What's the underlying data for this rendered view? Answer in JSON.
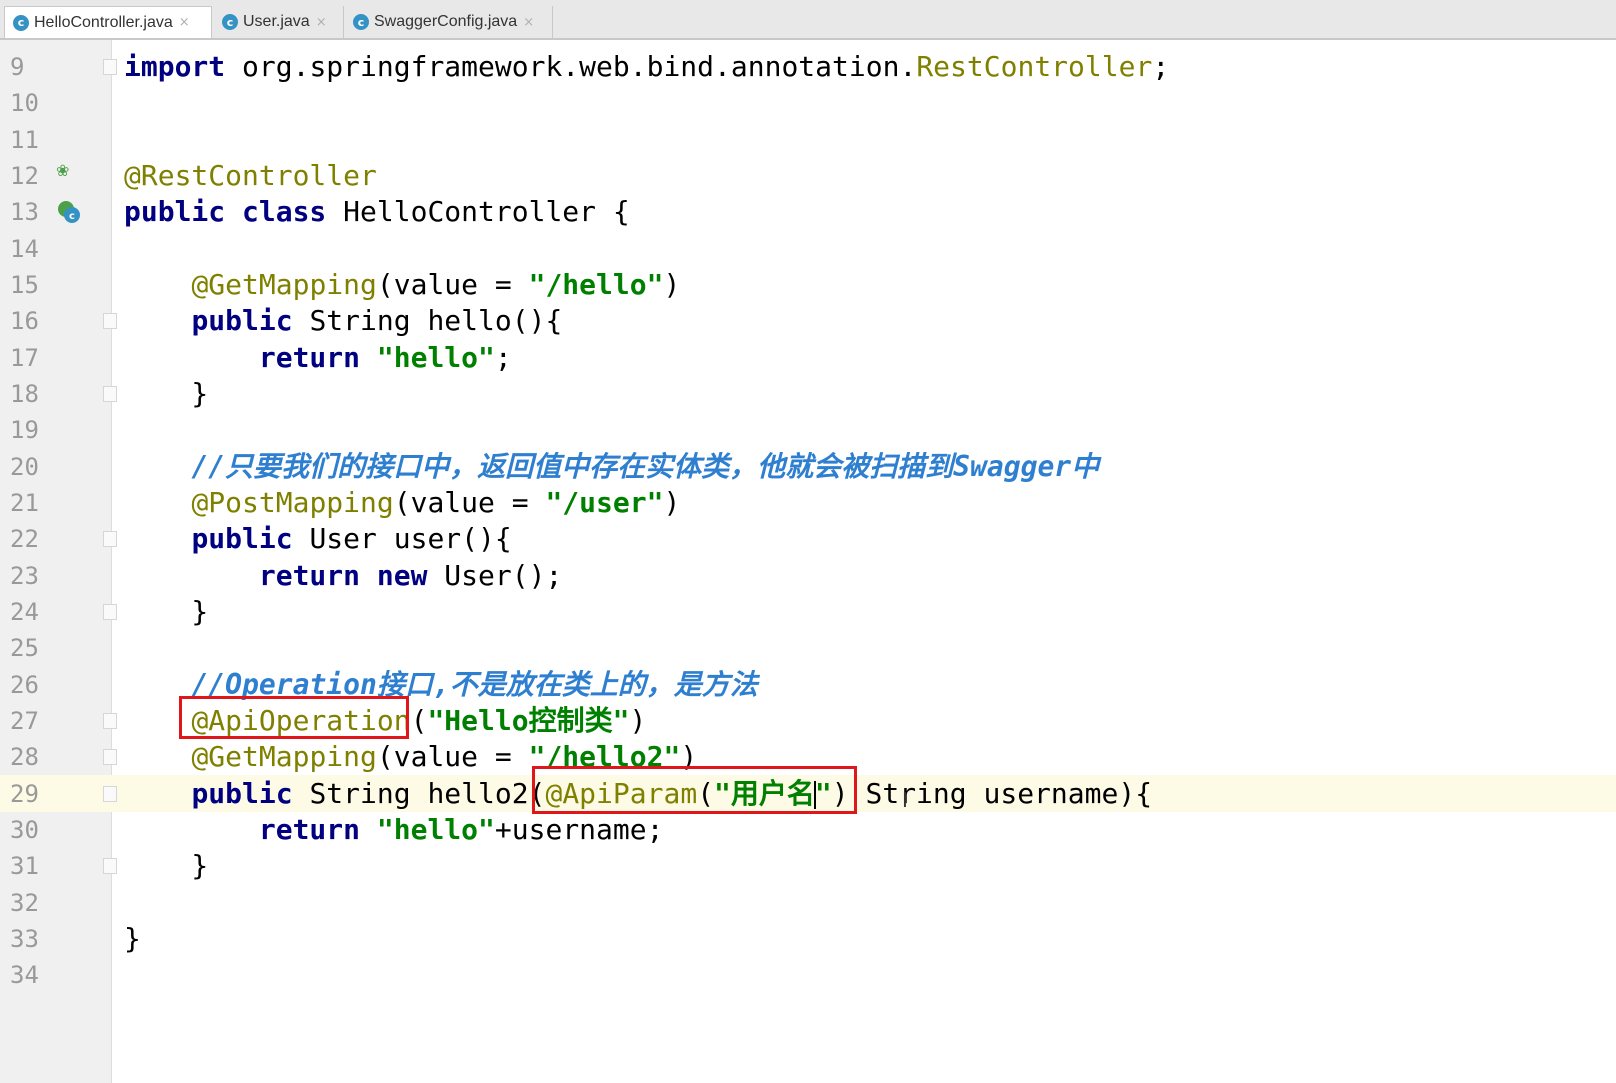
{
  "tabs": [
    {
      "label": "HelloController.java",
      "active": true,
      "icon": "java-class-icon",
      "icon_glyph": "c",
      "close_glyph": "×"
    },
    {
      "label": "User.java",
      "active": false,
      "icon": "java-class-icon",
      "icon_glyph": "c",
      "close_glyph": "×"
    },
    {
      "label": "SwaggerConfig.java",
      "active": false,
      "icon": "java-class-icon",
      "icon_glyph": "c",
      "close_glyph": "×"
    }
  ],
  "editor": {
    "current_line": 29,
    "lines": [
      {
        "n": "9",
        "segments": [
          [
            "kw",
            "import"
          ],
          [
            "plain",
            " org.springframework.web.bind.annotation."
          ],
          [
            "ann",
            "RestController"
          ],
          [
            "plain",
            ";"
          ]
        ],
        "fold": true
      },
      {
        "n": "10",
        "segments": []
      },
      {
        "n": "11",
        "segments": []
      },
      {
        "n": "12",
        "segments": [
          [
            "ann",
            "@RestController"
          ]
        ],
        "gutter_icon": "spring-bean-icon"
      },
      {
        "n": "13",
        "segments": [
          [
            "kw",
            "public class"
          ],
          [
            "plain",
            " HelloController {"
          ]
        ],
        "gutter_icon": "class-icon"
      },
      {
        "n": "14",
        "segments": []
      },
      {
        "n": "15",
        "segments": [
          [
            "plain",
            "    "
          ],
          [
            "ann",
            "@GetMapping"
          ],
          [
            "plain",
            "(value = "
          ],
          [
            "str",
            "\"/hello\""
          ],
          [
            "plain",
            ")"
          ]
        ]
      },
      {
        "n": "16",
        "segments": [
          [
            "plain",
            "    "
          ],
          [
            "kw",
            "public"
          ],
          [
            "plain",
            " String hello(){"
          ]
        ],
        "fold": true
      },
      {
        "n": "17",
        "segments": [
          [
            "plain",
            "        "
          ],
          [
            "kw",
            "return"
          ],
          [
            "plain",
            " "
          ],
          [
            "str",
            "\"hello\""
          ],
          [
            "plain",
            ";"
          ]
        ]
      },
      {
        "n": "18",
        "segments": [
          [
            "plain",
            "    }"
          ]
        ],
        "fold": true
      },
      {
        "n": "19",
        "segments": []
      },
      {
        "n": "20",
        "segments": [
          [
            "plain",
            "    "
          ],
          [
            "cmt",
            "//只要我们的接口中，返回值中存在实体类，他就会被扫描到Swagger中"
          ]
        ]
      },
      {
        "n": "21",
        "segments": [
          [
            "plain",
            "    "
          ],
          [
            "ann",
            "@PostMapping"
          ],
          [
            "plain",
            "(value = "
          ],
          [
            "str",
            "\"/user\""
          ],
          [
            "plain",
            ")"
          ]
        ]
      },
      {
        "n": "22",
        "segments": [
          [
            "plain",
            "    "
          ],
          [
            "kw",
            "public"
          ],
          [
            "plain",
            " User user(){"
          ]
        ],
        "fold": true
      },
      {
        "n": "23",
        "segments": [
          [
            "plain",
            "        "
          ],
          [
            "kw",
            "return new"
          ],
          [
            "plain",
            " User();"
          ]
        ]
      },
      {
        "n": "24",
        "segments": [
          [
            "plain",
            "    }"
          ]
        ],
        "fold": true
      },
      {
        "n": "25",
        "segments": []
      },
      {
        "n": "26",
        "segments": [
          [
            "plain",
            "    "
          ],
          [
            "cmt",
            "//Operation接口,不是放在类上的，是方法"
          ]
        ]
      },
      {
        "n": "27",
        "segments": [
          [
            "plain",
            "    "
          ],
          [
            "ann",
            "@ApiOperation"
          ],
          [
            "plain",
            "("
          ],
          [
            "str",
            "\"Hello控制类\""
          ],
          [
            "plain",
            ")"
          ]
        ],
        "fold": true
      },
      {
        "n": "28",
        "segments": [
          [
            "plain",
            "    "
          ],
          [
            "ann",
            "@GetMapping"
          ],
          [
            "plain",
            "(value = "
          ],
          [
            "str",
            "\"/hello2\""
          ],
          [
            "plain",
            ")"
          ]
        ],
        "fold": true
      },
      {
        "n": "29",
        "segments": [
          [
            "plain",
            "    "
          ],
          [
            "kw",
            "public"
          ],
          [
            "plain",
            " String hello2("
          ],
          [
            "ann",
            "@ApiParam"
          ],
          [
            "plain",
            "("
          ],
          [
            "str",
            "\"用户名"
          ],
          [
            "caret",
            ""
          ],
          [
            "str",
            "\""
          ],
          [
            "plain",
            ") String username){"
          ]
        ],
        "fold": true
      },
      {
        "n": "30",
        "segments": [
          [
            "plain",
            "        "
          ],
          [
            "kw",
            "return"
          ],
          [
            "plain",
            " "
          ],
          [
            "str",
            "\"hello\""
          ],
          [
            "plain",
            "+username;"
          ]
        ]
      },
      {
        "n": "31",
        "segments": [
          [
            "plain",
            "    }"
          ]
        ],
        "fold": true
      },
      {
        "n": "32",
        "segments": []
      },
      {
        "n": "33",
        "segments": [
          [
            "plain",
            "}"
          ]
        ]
      },
      {
        "n": "34",
        "segments": []
      }
    ]
  },
  "highlights": [
    {
      "name": "api-operation-highlight"
    },
    {
      "name": "api-param-highlight"
    }
  ],
  "colors": {
    "keyword": "#000080",
    "annotation": "#808000",
    "string": "#008000",
    "comment": "#2f7fd0",
    "highlight": "#e0161a",
    "current_line": "#fdfbe6"
  }
}
